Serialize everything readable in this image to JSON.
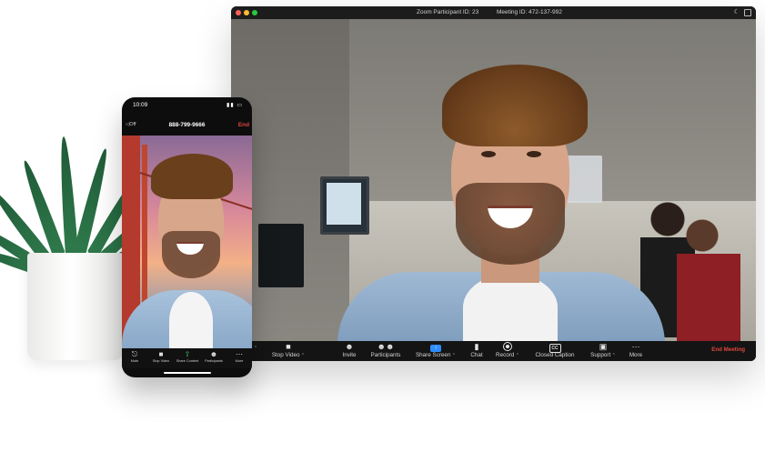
{
  "desktop": {
    "title_participant": "Zoom Participant ID: 23",
    "title_meeting": "Meeting ID: 472-137-992",
    "toolbar": [
      {
        "name": "mute",
        "label": "",
        "icon": "caret-icon"
      },
      {
        "name": "stop-video",
        "label": "Stop Video",
        "icon": "video-camera-icon"
      },
      {
        "name": "invite",
        "label": "Invite",
        "icon": "add-person-icon"
      },
      {
        "name": "participants",
        "label": "Participants",
        "icon": "participants-icon"
      },
      {
        "name": "share-screen",
        "label": "Share Screen",
        "icon": "share-screen-icon"
      },
      {
        "name": "chat",
        "label": "Chat",
        "icon": "chat-icon"
      },
      {
        "name": "record",
        "label": "Record",
        "icon": "record-icon"
      },
      {
        "name": "closed-caption",
        "label": "Closed Caption",
        "icon": "cc-icon"
      },
      {
        "name": "support",
        "label": "Support",
        "icon": "support-icon"
      },
      {
        "name": "more",
        "label": "More",
        "icon": "more-icon"
      }
    ],
    "end_meeting": "End Meeting",
    "colors": {
      "accent": "#2d8cff",
      "end": "#e0453d"
    }
  },
  "phone": {
    "time": "10:09",
    "audio": "Off",
    "number": "888-799-9666",
    "end": "End",
    "toolbar": [
      {
        "name": "mute",
        "label": "Mute"
      },
      {
        "name": "stop-video",
        "label": "Stop Video"
      },
      {
        "name": "share-content",
        "label": "Share Content"
      },
      {
        "name": "participants",
        "label": "Participants"
      },
      {
        "name": "more",
        "label": "More"
      }
    ]
  }
}
